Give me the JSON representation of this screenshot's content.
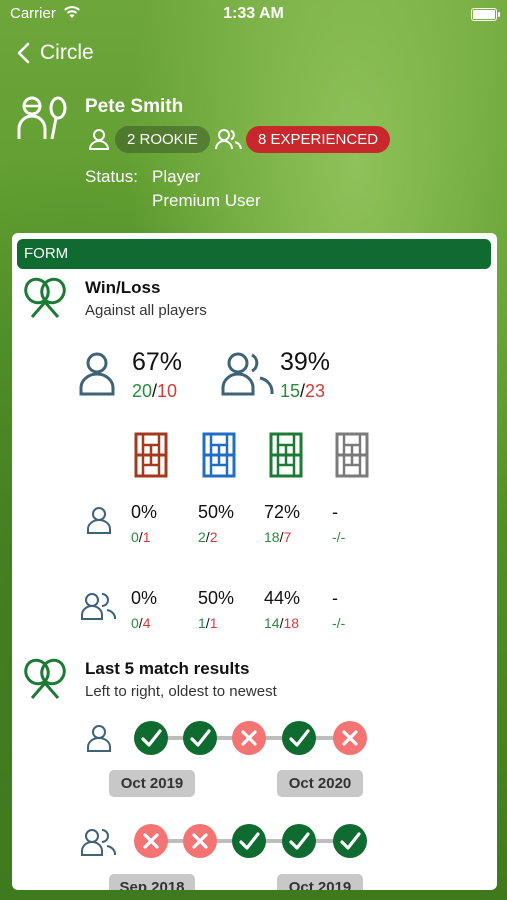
{
  "status_bar": {
    "carrier": "Carrier",
    "time": "1:33 AM"
  },
  "nav": {
    "back_label": "Circle"
  },
  "profile": {
    "name": "Pete Smith",
    "rookie_label": "2 ROOKIE",
    "experienced_label": "8 EXPERIENCED",
    "status_label": "Status:",
    "status_values": [
      "Player",
      "Premium User"
    ]
  },
  "form": {
    "header": "FORM",
    "winloss": {
      "title": "Win/Loss",
      "subtitle": "Against all players",
      "singles": {
        "pct": "67%",
        "wins": "20",
        "losses": "10"
      },
      "doubles": {
        "pct": "39%",
        "wins": "15",
        "losses": "23"
      },
      "court_colors": [
        "#a33a1d",
        "#1f6ec4",
        "#1b7a34",
        "#7a7a7a"
      ],
      "singles_row": [
        {
          "pct": "0%",
          "wins": "0",
          "losses": "1"
        },
        {
          "pct": "50%",
          "wins": "2",
          "losses": "2"
        },
        {
          "pct": "72%",
          "wins": "18",
          "losses": "7"
        },
        {
          "pct": "-",
          "wins": "-",
          "losses": "-"
        }
      ],
      "doubles_row": [
        {
          "pct": "0%",
          "wins": "0",
          "losses": "4"
        },
        {
          "pct": "50%",
          "wins": "1",
          "losses": "1"
        },
        {
          "pct": "44%",
          "wins": "14",
          "losses": "18"
        },
        {
          "pct": "-",
          "wins": "-",
          "losses": "-"
        }
      ]
    },
    "last5": {
      "title": "Last 5 match results",
      "subtitle": "Left to right, oldest to newest",
      "singles": {
        "results": [
          "win",
          "win",
          "loss",
          "win",
          "loss"
        ],
        "start_date": "Oct 2019",
        "end_date": "Oct 2020"
      },
      "doubles": {
        "results": [
          "loss",
          "loss",
          "win",
          "win",
          "win"
        ],
        "start_date": "Sep 2018",
        "end_date": "Oct 2019"
      }
    }
  }
}
